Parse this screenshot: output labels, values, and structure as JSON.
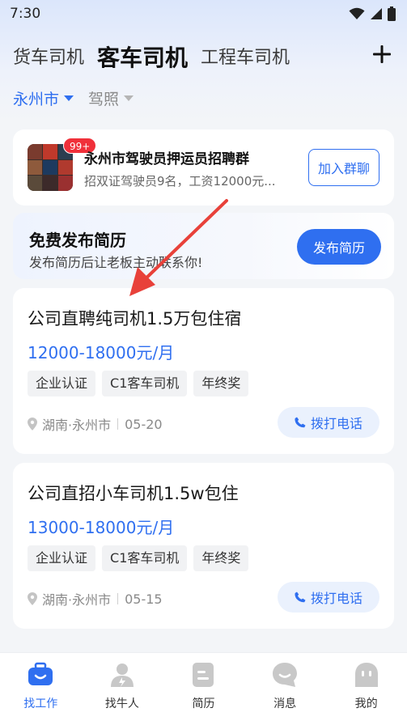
{
  "status_bar": {
    "time": "7:30"
  },
  "top_tabs": [
    "货车司机",
    "客车司机",
    "工程车司机"
  ],
  "active_tab_index": 1,
  "filters": {
    "city": "永州市",
    "license": "驾照"
  },
  "group": {
    "badge": "99+",
    "title": "永州市驾驶员押运员招聘群",
    "desc": "招双证驾驶员9名，工资12000元...",
    "join_label": "加入群聊"
  },
  "resume_banner": {
    "title": "免费发布简历",
    "subtitle": "发布简历后让老板主动联系你!",
    "button": "发布简历"
  },
  "jobs": [
    {
      "title": "公司直聘纯司机1.5万包住宿",
      "salary": "12000-18000元/月",
      "tags": [
        "企业认证",
        "C1客车司机",
        "年终奖"
      ],
      "location": "湖南·永州市",
      "date": "05-20",
      "call_label": "拨打电话"
    },
    {
      "title": "公司直招小车司机1.5w包住",
      "salary": "13000-18000元/月",
      "tags": [
        "企业认证",
        "C1客车司机",
        "年终奖"
      ],
      "location": "湖南·永州市",
      "date": "05-15",
      "call_label": "拨打电话"
    }
  ],
  "bottom_nav": [
    "找工作",
    "找牛人",
    "简历",
    "消息",
    "我的"
  ],
  "active_nav_index": 0,
  "colors": {
    "accent": "#2f6ff0",
    "badge": "#f0303a",
    "arrow": "#e8413a"
  },
  "icons": [
    "wifi-icon",
    "signal-icon",
    "battery-icon",
    "plus-icon",
    "location-pin-icon",
    "phone-icon",
    "briefcase-icon",
    "worker-icon",
    "resume-icon",
    "message-icon",
    "profile-icon"
  ]
}
